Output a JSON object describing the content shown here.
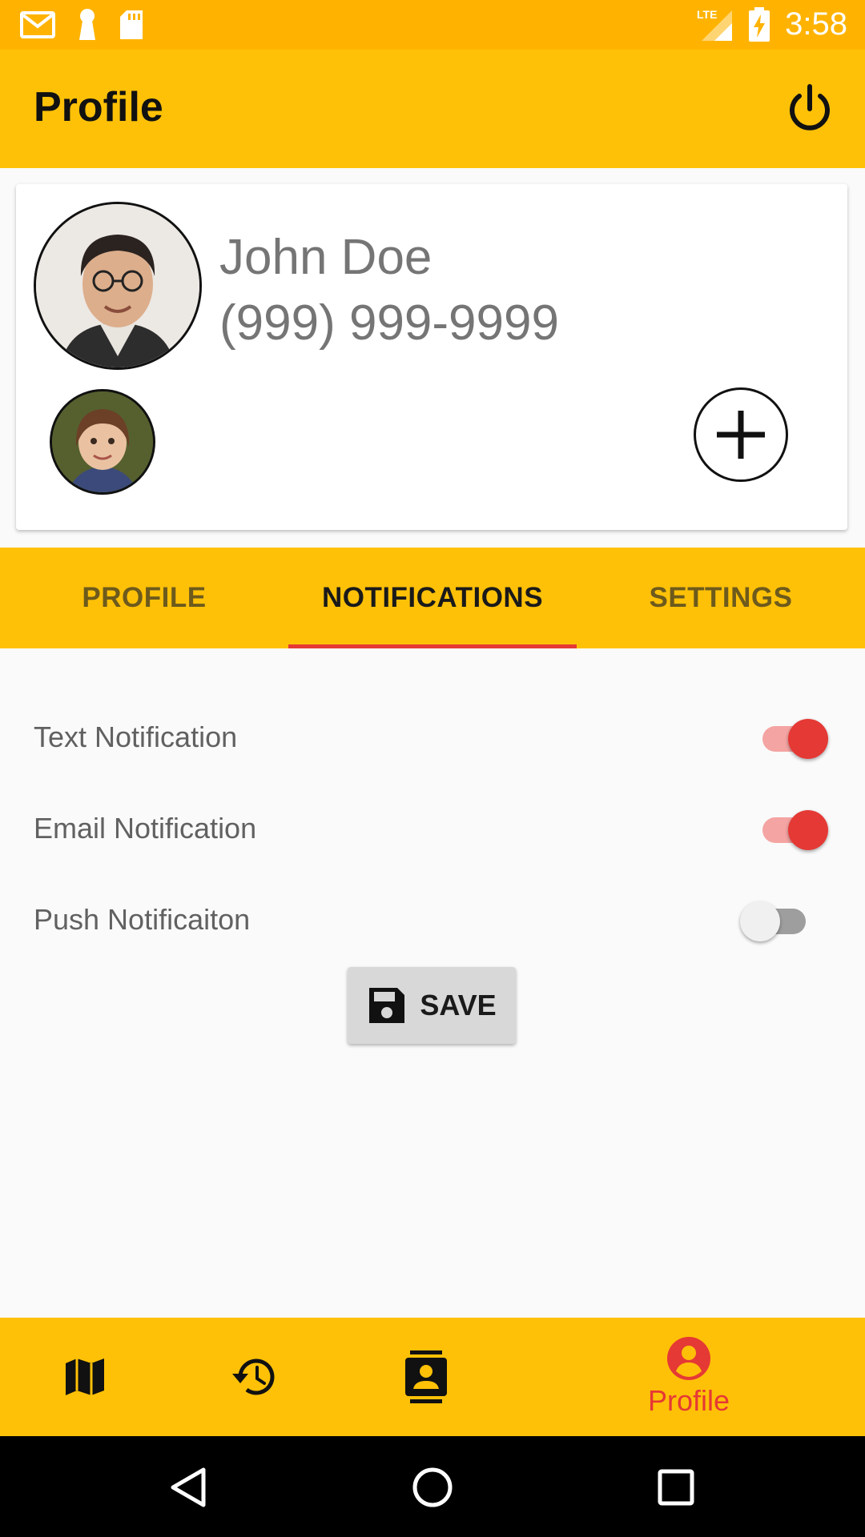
{
  "status_bar": {
    "time": "3:58",
    "network": "LTE",
    "left_icons": [
      "gmail-icon",
      "keyhole-icon",
      "sd-card-icon"
    ],
    "right_icons": [
      "signal-icon",
      "battery-charging-icon"
    ]
  },
  "app_bar": {
    "title": "Profile",
    "power_icon": "power-icon"
  },
  "profile_card": {
    "name": "John Doe",
    "phone": "(999) 999-9999",
    "add_icon": "plus-icon"
  },
  "tabs": [
    {
      "label": "PROFILE",
      "active": false
    },
    {
      "label": "NOTIFICATIONS",
      "active": true
    },
    {
      "label": "SETTINGS",
      "active": false
    }
  ],
  "notifications": [
    {
      "label": "Text Notification",
      "enabled": true
    },
    {
      "label": "Email Notification",
      "enabled": true
    },
    {
      "label": "Push Notificaiton",
      "enabled": false
    }
  ],
  "save_button": {
    "label": "SAVE",
    "icon": "floppy-disk-icon"
  },
  "bottom_nav": [
    {
      "icon": "map-icon",
      "label": "",
      "active": false
    },
    {
      "icon": "history-icon",
      "label": "",
      "active": false
    },
    {
      "icon": "contacts-icon",
      "label": "",
      "active": false
    },
    {
      "icon": "account-circle-icon",
      "label": "Profile",
      "active": true
    }
  ],
  "system_nav": [
    "back-icon",
    "home-icon",
    "recents-icon"
  ],
  "colors": {
    "status_bar": "#ffb300",
    "primary": "#ffc107",
    "accent": "#e53935",
    "switch_on_track": "#f4a4a2",
    "background": "#fafafa",
    "save_button": "#d8d8d8"
  }
}
